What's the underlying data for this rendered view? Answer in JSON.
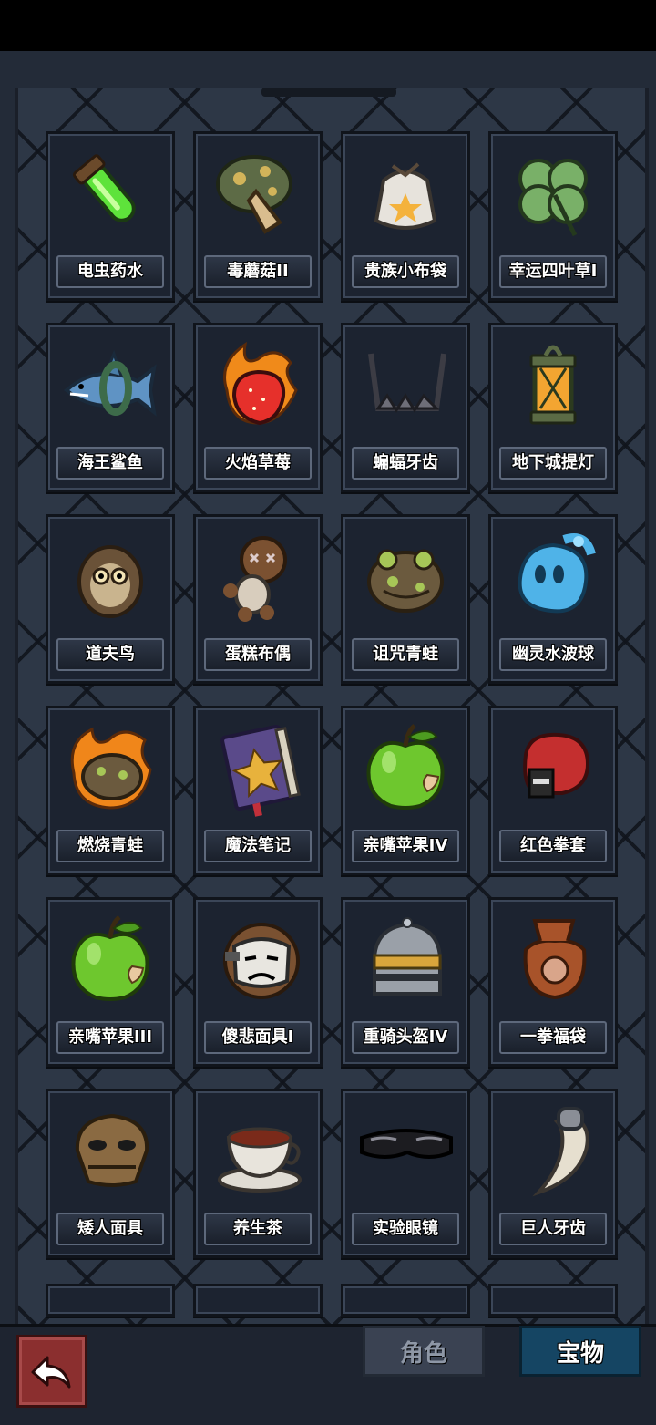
{
  "tabs": {
    "role": "角色",
    "treasure": "宝物"
  },
  "items": [
    {
      "name": "电虫药水",
      "icon": "green-potion-icon"
    },
    {
      "name": "毒蘑菇II",
      "icon": "poison-mushroom-icon"
    },
    {
      "name": "贵族小布袋",
      "icon": "noble-pouch-icon"
    },
    {
      "name": "幸运四叶草I",
      "icon": "four-leaf-clover-icon"
    },
    {
      "name": "海王鲨鱼",
      "icon": "shark-icon"
    },
    {
      "name": "火焰草莓",
      "icon": "fire-strawberry-icon"
    },
    {
      "name": "蝙蝠牙齿",
      "icon": "bat-teeth-icon"
    },
    {
      "name": "地下城提灯",
      "icon": "dungeon-lantern-icon"
    },
    {
      "name": "道夫鸟",
      "icon": "owl-icon"
    },
    {
      "name": "蛋糕布偶",
      "icon": "voodoo-doll-icon"
    },
    {
      "name": "诅咒青蛙",
      "icon": "cursed-frog-icon"
    },
    {
      "name": "幽灵水波球",
      "icon": "ghost-water-orb-icon"
    },
    {
      "name": "燃烧青蛙",
      "icon": "burning-frog-icon"
    },
    {
      "name": "魔法笔记",
      "icon": "magic-book-icon"
    },
    {
      "name": "亲嘴苹果IV",
      "icon": "green-apple-icon"
    },
    {
      "name": "红色拳套",
      "icon": "boxing-glove-icon"
    },
    {
      "name": "亲嘴苹果III",
      "icon": "green-apple-icon"
    },
    {
      "name": "傻悲面具I",
      "icon": "sad-mask-icon"
    },
    {
      "name": "重骑头盔IV",
      "icon": "knight-helmet-icon"
    },
    {
      "name": "一拳福袋",
      "icon": "fist-bag-icon"
    },
    {
      "name": "矮人面具",
      "icon": "dwarf-mask-icon"
    },
    {
      "name": "养生茶",
      "icon": "tea-cup-icon"
    },
    {
      "name": "实验眼镜",
      "icon": "lab-goggles-icon"
    },
    {
      "name": "巨人牙齿",
      "icon": "giant-tooth-icon"
    }
  ],
  "colors": {
    "panel": "#2d3746",
    "tab_active": "#154563",
    "tab_inactive": "#3a4252",
    "back_button": "#8b2f2f"
  }
}
